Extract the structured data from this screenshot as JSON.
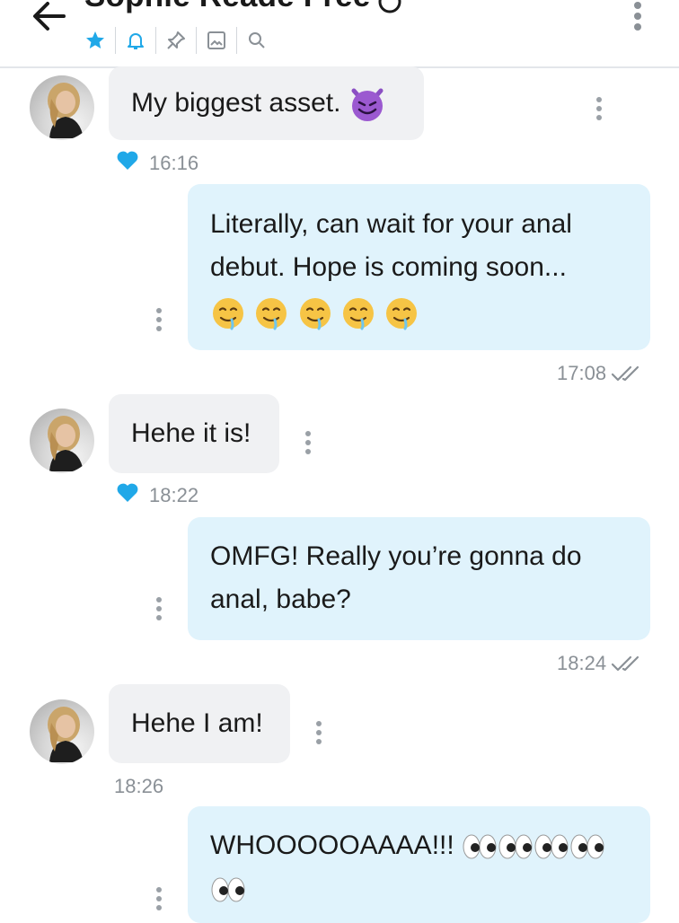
{
  "header": {
    "title": "Sophie Reade Free",
    "toolbar": [
      "star-icon",
      "bell-icon",
      "pin-icon",
      "image-icon",
      "search-icon"
    ]
  },
  "colors": {
    "accent": "#20a8e8",
    "incoming_bubble": "#f0f1f3",
    "outgoing_bubble": "#e0f3fc",
    "meta_text": "#8a9096"
  },
  "messages": [
    {
      "id": "m1",
      "direction": "incoming",
      "text": "My biggest asset. ",
      "emoji": [
        "smiling-imp"
      ],
      "time": "16:16",
      "liked": true
    },
    {
      "id": "m2",
      "direction": "outgoing",
      "text": "Literally, can wait for your anal\ndebut. Hope is coming soon...",
      "emoji": [
        "drooling-face",
        "drooling-face",
        "drooling-face",
        "drooling-face",
        "drooling-face"
      ],
      "time": "17:08",
      "read": true
    },
    {
      "id": "m3",
      "direction": "incoming",
      "text": "Hehe it is!",
      "time": "18:22",
      "liked": true
    },
    {
      "id": "m4",
      "direction": "outgoing",
      "text": "OMFG! Really you’re gonna do\nanal, babe?",
      "time": "18:24",
      "read": true
    },
    {
      "id": "m5",
      "direction": "incoming",
      "text": "Hehe I am!",
      "time": "18:26",
      "liked": false
    },
    {
      "id": "m6",
      "direction": "outgoing",
      "text": "WHOOOOOAAAA!!! ",
      "emoji": [
        "eyes",
        "eyes",
        "eyes",
        "eyes",
        "eyes",
        "eyes",
        "eyes",
        "eyes"
      ]
    }
  ]
}
